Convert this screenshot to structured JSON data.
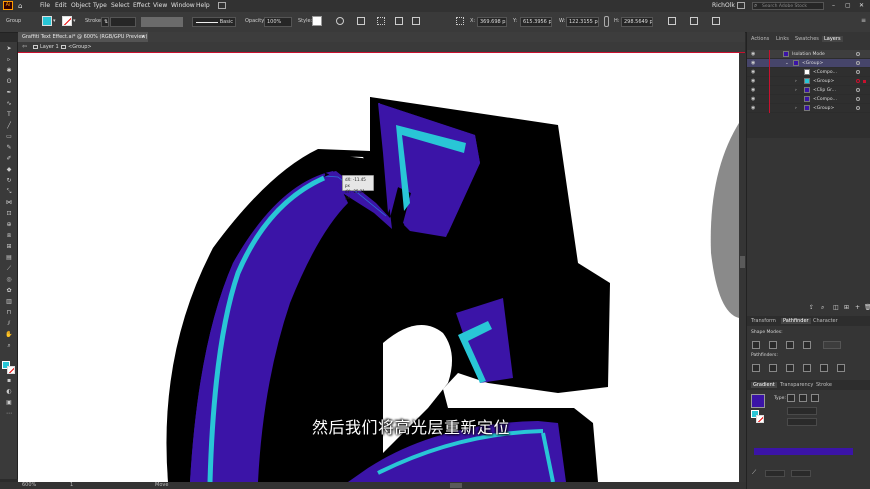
{
  "menubar": {
    "app_badge": "Ai",
    "items": [
      "File",
      "Edit",
      "Object",
      "Type",
      "Select",
      "Effect",
      "View",
      "Window",
      "Help"
    ],
    "user": "RichOlk",
    "search_placeholder": "Search Adobe Stock"
  },
  "control_bar": {
    "selection_label": "Group",
    "stroke_label": "Stroke:",
    "brush_label": "Basic",
    "opacity_label": "Opacity:",
    "opacity_value": "100%",
    "style_label": "Style:",
    "x_label": "X:",
    "x_value": "369.698 px",
    "y_label": "Y:",
    "y_value": "615.3956 px",
    "w_label": "W:",
    "w_value": "122.3155 px",
    "h_label": "H:",
    "h_value": "298.5649 px",
    "fill_color": "#29c6d6"
  },
  "document": {
    "tab_title": "Graffiti Text Effect.ai* @ 600% (RGB/GPU Preview)",
    "breadcrumb": [
      "Layer 1",
      "<Group>"
    ]
  },
  "tooltip": {
    "line1": "dX: -11.45 px",
    "line2": "dY: -25.21 px"
  },
  "subtitle": "然后我们将高光层重新定位",
  "status": {
    "zoom": "600%",
    "artboard": "1",
    "mode": "Move"
  },
  "right_panel": {
    "top_tabs": [
      "Actions",
      "Links",
      "Swatches",
      "Layers"
    ],
    "active_top_tab": "Layers",
    "layers": [
      {
        "name": "Isolation Mode"
      },
      {
        "name": "<Group>"
      },
      {
        "name": "<Compo..."
      },
      {
        "name": "<Group>"
      },
      {
        "name": "<Clip Gr..."
      },
      {
        "name": "<Compo..."
      },
      {
        "name": "<Group>"
      }
    ],
    "mid_tabs": [
      "Transform",
      "Pathfinder",
      "Character"
    ],
    "active_mid_tab": "Pathfinder",
    "shape_modes_label": "Shape Modes:",
    "pathfinders_label": "Pathfinders:",
    "bottom_tabs": [
      "Gradient",
      "Transparency",
      "Stroke"
    ],
    "active_bottom_tab": "Gradient",
    "gradient_type_label": "Type:",
    "gradient_color": "#3b14a7"
  },
  "colors": {
    "purple": "#3b14a7",
    "cyan": "#29c6d6",
    "black": "#000000",
    "accent_red": "#c8102e"
  }
}
